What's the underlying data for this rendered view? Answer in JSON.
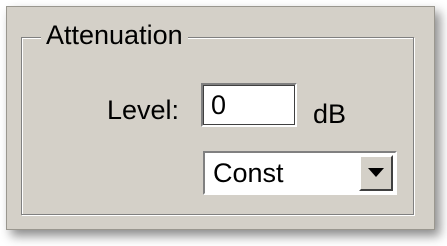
{
  "group": {
    "title": "Attenuation"
  },
  "level": {
    "label": "Level:",
    "value": "0",
    "unit": "dB"
  },
  "mode": {
    "selected": "Const"
  }
}
